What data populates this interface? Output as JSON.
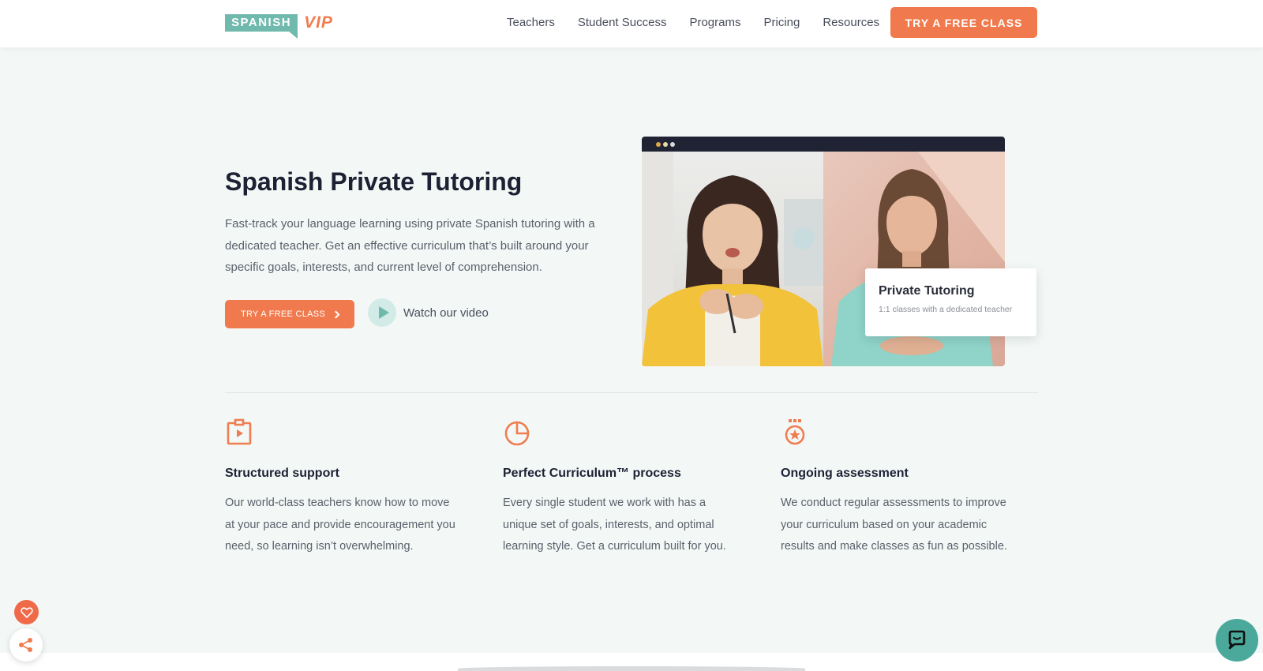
{
  "header": {
    "logo_text": "SPANISH",
    "logo_accent": "VIP",
    "nav": [
      "Teachers",
      "Student Success",
      "Programs",
      "Pricing",
      "Resources"
    ],
    "cta_label": "TRY A FREE CLASS"
  },
  "hero": {
    "title": "Spanish Private Tutoring",
    "description": "Fast-track your language learning using private Spanish tutoring with a dedicated teacher. Get an effective curriculum that’s built around your specific goals, interests, and current level of comprehension.",
    "cta_label": "TRY A FREE CLASS",
    "video_label": "Watch our video"
  },
  "video_card": {
    "title": "Private Tutoring",
    "subtitle": "1:1 classes with a dedicated teacher"
  },
  "features": [
    {
      "icon": "clipboard-play-icon",
      "title": "Structured support",
      "description": "Our world-class teachers know how to move at your pace and provide encouragement you need, so learning isn’t overwhelming."
    },
    {
      "icon": "pie-chart-icon",
      "title": "Perfect Curriculum™ process",
      "description": "Every single student we work with has a unique set of goals, interests, and optimal learning style. Get a curriculum built for you."
    },
    {
      "icon": "medal-icon",
      "title": "Ongoing assessment",
      "description": "We conduct regular assessments to improve your curriculum based on your academic results and make classes as fun as possible."
    }
  ],
  "colors": {
    "accent_orange": "#f07a4d",
    "brand_teal": "#6fb9ad",
    "heading": "#1d2133",
    "background": "#f3f8f7"
  }
}
